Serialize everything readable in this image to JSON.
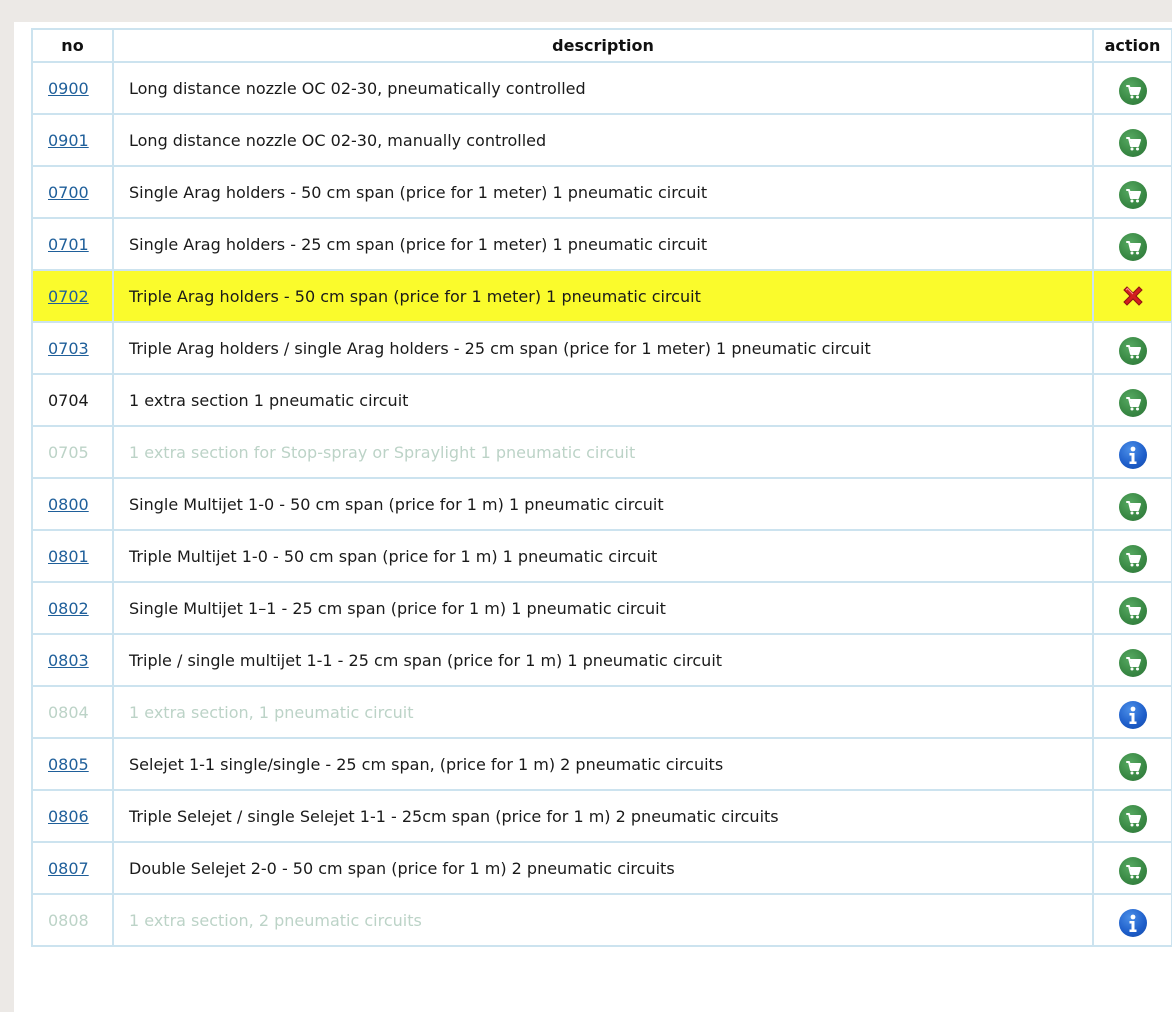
{
  "headers": {
    "no": "no",
    "description": "description",
    "action": "action"
  },
  "rows": [
    {
      "no": "0900",
      "description": "Long distance nozzle OC 02-30, pneumatically controlled",
      "action": "cart-icon",
      "state": "link"
    },
    {
      "no": "0901",
      "description": "Long distance nozzle OC 02-30, manually controlled",
      "action": "cart-icon",
      "state": "link"
    },
    {
      "no": "0700",
      "description": "Single Arag holders - 50 cm span (price for 1 meter) 1 pneumatic circuit",
      "action": "cart-icon",
      "state": "link"
    },
    {
      "no": "0701",
      "description": "Single Arag holders - 25 cm span (price for 1 meter) 1 pneumatic circuit",
      "action": "cart-icon",
      "state": "link"
    },
    {
      "no": "0702",
      "description": "Triple Arag holders - 50 cm span (price for 1 meter) 1 pneumatic circuit",
      "action": "remove-icon",
      "state": "highlighted"
    },
    {
      "no": "0703",
      "description": "Triple Arag holders / single Arag holders - 25 cm span (price for 1 meter) 1 pneumatic circuit",
      "action": "cart-icon",
      "state": "link"
    },
    {
      "no": "0704",
      "description": "1 extra section 1 pneumatic circuit",
      "action": "cart-icon",
      "state": "plain"
    },
    {
      "no": "0705",
      "description": "1 extra section for Stop-spray or Spraylight 1 pneumatic circuit",
      "action": "info-icon",
      "state": "disabled"
    },
    {
      "no": "0800",
      "description": "Single Multijet 1-0 - 50 cm span (price for 1 m) 1 pneumatic circuit",
      "action": "cart-icon",
      "state": "link"
    },
    {
      "no": "0801",
      "description": "Triple Multijet 1-0 - 50 cm span (price for 1 m) 1 pneumatic circuit",
      "action": "cart-icon",
      "state": "link"
    },
    {
      "no": "0802",
      "description": "Single Multijet 1–1 - 25 cm span (price for 1 m) 1 pneumatic circuit",
      "action": "cart-icon",
      "state": "link"
    },
    {
      "no": "0803",
      "description": "Triple / single multijet 1-1 - 25 cm span (price for 1 m) 1 pneumatic circuit",
      "action": "cart-icon",
      "state": "link"
    },
    {
      "no": "0804",
      "description": "1 extra section, 1 pneumatic circuit",
      "action": "info-icon",
      "state": "disabled"
    },
    {
      "no": "0805",
      "description": "Selejet 1-1 single/single - 25 cm span, (price for 1 m) 2 pneumatic circuits",
      "action": "cart-icon",
      "state": "link"
    },
    {
      "no": "0806",
      "description": "Triple Selejet / single Selejet 1-1 - 25cm span (price for 1 m) 2 pneumatic circuits",
      "action": "cart-icon",
      "state": "link"
    },
    {
      "no": "0807",
      "description": "Double Selejet 2-0 - 50 cm span (price for 1 m) 2 pneumatic circuits",
      "action": "cart-icon",
      "state": "link"
    },
    {
      "no": "0808",
      "description": "1 extra section, 2 pneumatic circuits",
      "action": "info-icon",
      "state": "disabled"
    }
  ],
  "colors": {
    "border": "#cce3ef",
    "link": "#1f5f9a",
    "highlight": "#fafb2c",
    "disabled_text": "#bcd3c7",
    "cart_green": "#3a8a45",
    "info_blue": "#1d5dc9",
    "remove_red": "#d21f1f"
  }
}
